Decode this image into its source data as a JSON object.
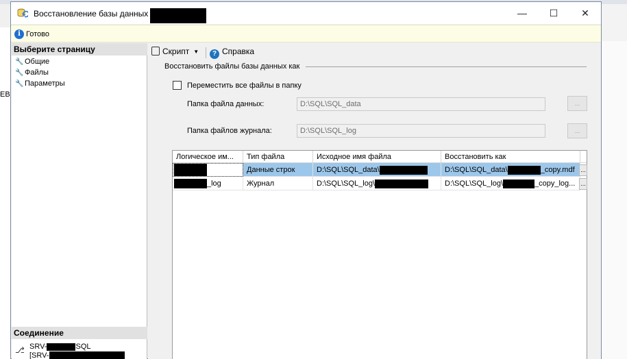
{
  "window": {
    "title": "Восстановление базы данных -"
  },
  "background": {
    "left_fragment": "EBI"
  },
  "status": {
    "text": "Готово"
  },
  "left_pane": {
    "select_page_header": "Выберите страницу",
    "pages": [
      {
        "label": "Общие"
      },
      {
        "label": "Файлы"
      },
      {
        "label": "Параметры"
      }
    ],
    "connection_header": "Соединение",
    "connection_line1_prefix": "SRV-",
    "connection_line1_suffix": "SQL",
    "connection_line2_prefix": "[SRV-"
  },
  "toolbar": {
    "script_label": "Скрипт",
    "help_label": "Справка"
  },
  "files_section": {
    "title": "Восстановить файлы базы данных как",
    "relocate_checkbox_label": "Переместить все файлы в папку",
    "relocate_checked": false,
    "data_folder_label": "Папка файла данных:",
    "data_folder_value": "D:\\SQL\\SQL_data",
    "log_folder_label": "Папка файлов журнала:",
    "log_folder_value": "D:\\SQL\\SQL_log",
    "browse_label": "..."
  },
  "grid": {
    "columns": [
      "Логическое им...",
      "Тип файла",
      "Исходное имя файла",
      "Восстановить как"
    ],
    "rows": [
      {
        "logical_suffix": "",
        "type": "Данные строк",
        "original_prefix": "D:\\SQL\\SQL_data\\",
        "restore_prefix": "D:\\SQL\\SQL_data\\",
        "restore_suffix": "_copy.mdf",
        "selected": true
      },
      {
        "logical_suffix": "_log",
        "type": "Журнал",
        "original_prefix": "D:\\SQL\\SQL_log\\",
        "restore_prefix": "D:\\SQL\\SQL_log\\",
        "restore_suffix": "_copy_log...",
        "selected": false
      }
    ],
    "row_button_label": "..."
  }
}
